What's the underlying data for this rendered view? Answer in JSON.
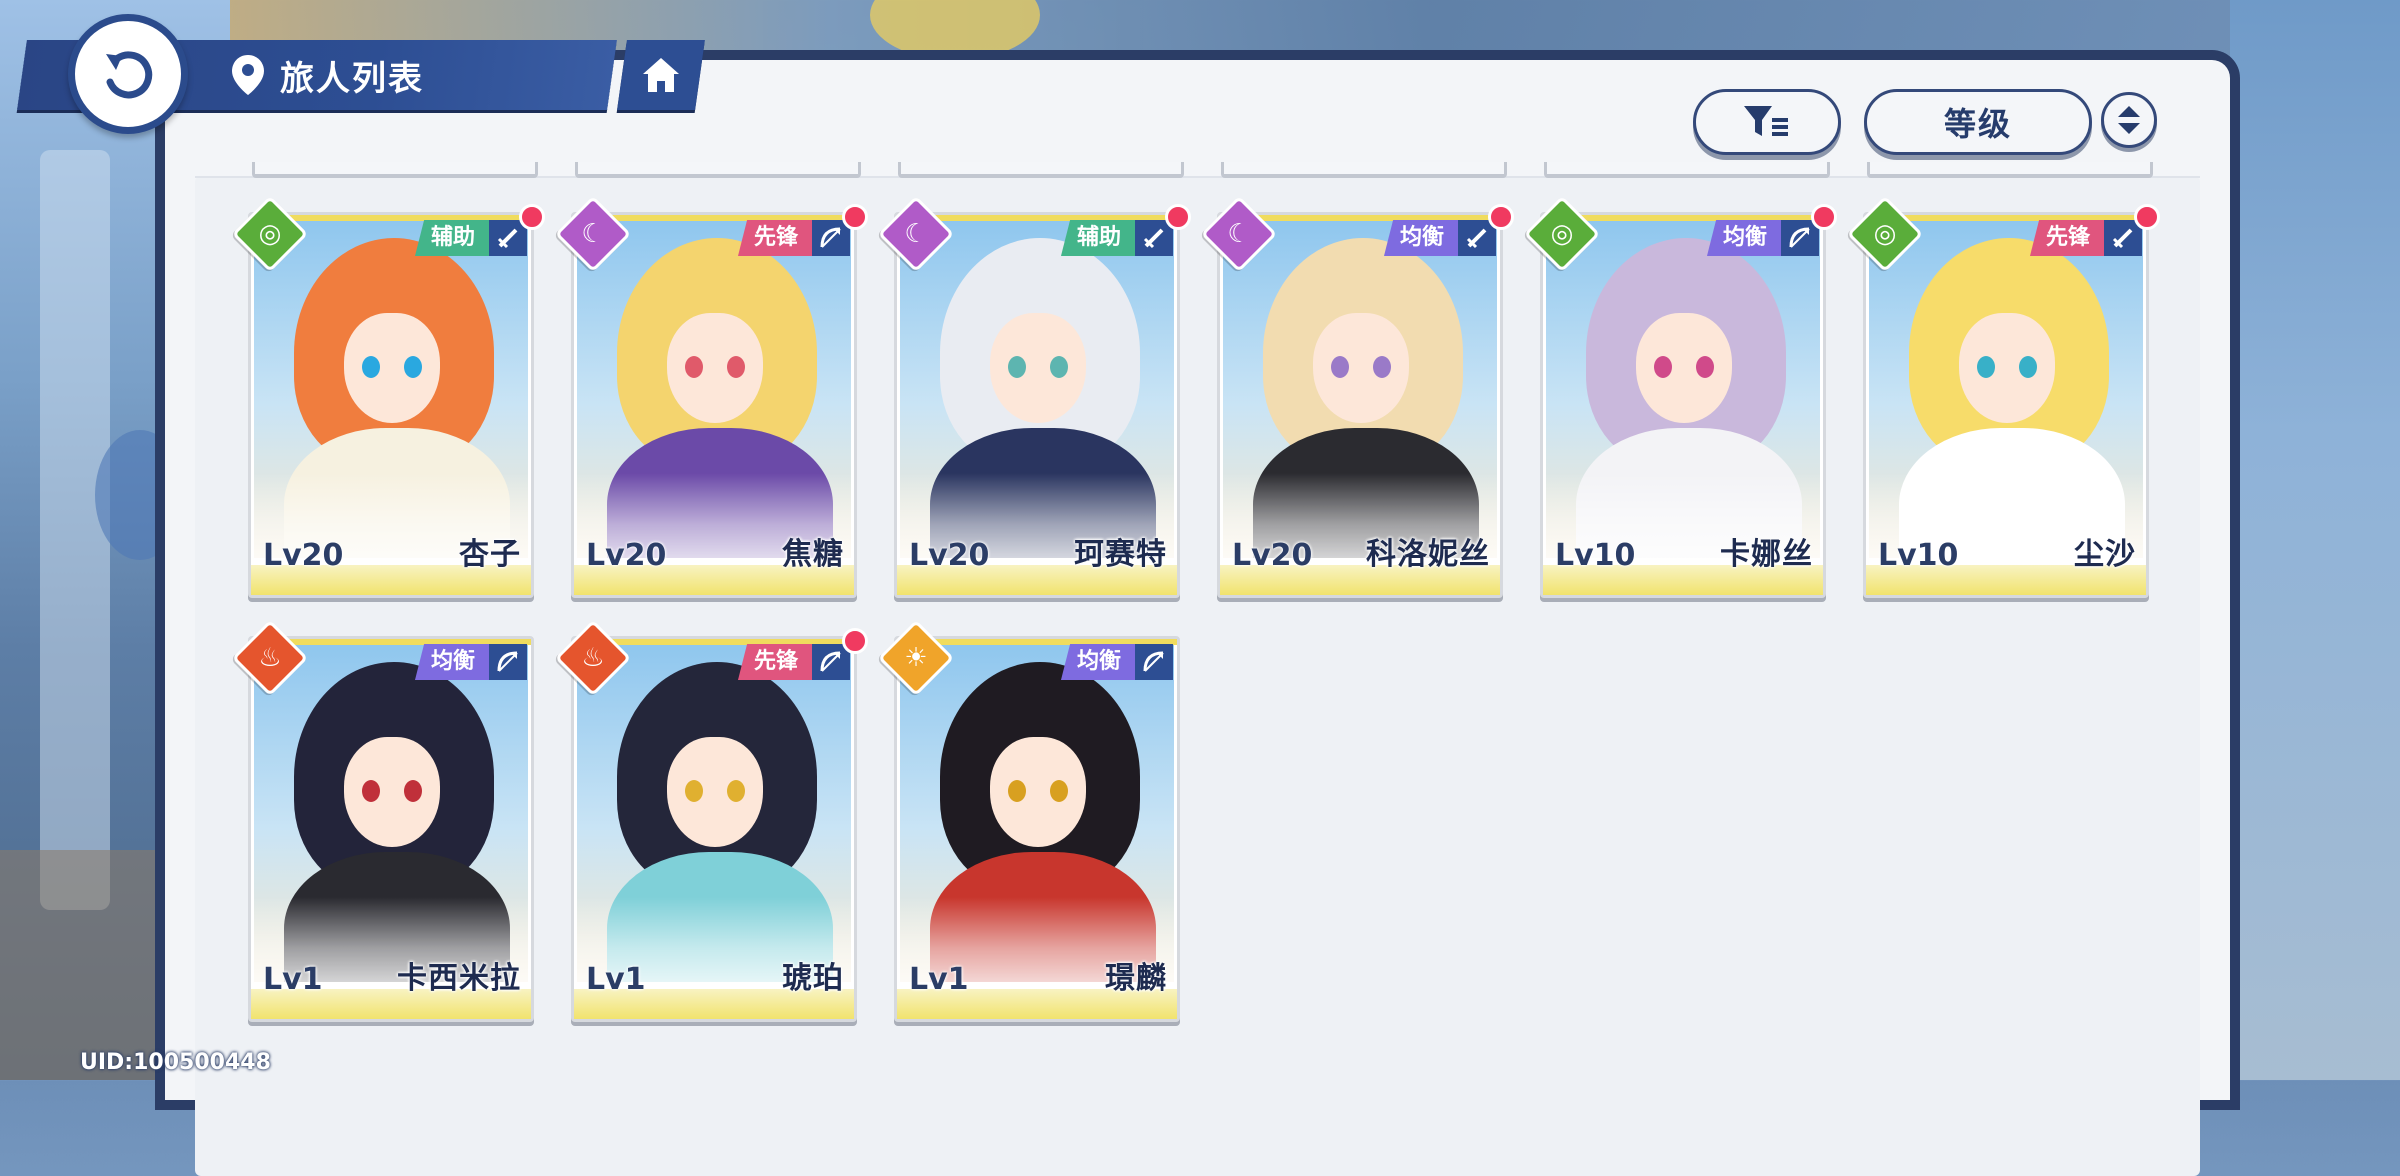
{
  "header": {
    "title": "旅人列表",
    "back_icon": "back-arrow-icon",
    "home_icon": "home-icon",
    "location_icon": "location-pin-icon"
  },
  "controls": {
    "filter_icon": "filter-icon",
    "sort_label": "等级",
    "order_icon": "sort-order-icon"
  },
  "colors": {
    "navy": "#2d4e93",
    "role_support": "#43b58a",
    "role_vanguard": "#e0557e",
    "role_balance": "#7e6be0",
    "elem_wind": "#5aad3a",
    "elem_moon": "#b05bc8",
    "elem_fire": "#e5552d",
    "elem_sun": "#f0a42a",
    "notify_dot": "#f03a60"
  },
  "characters": [
    {
      "level": "Lv20",
      "name": "杏子",
      "role": "辅助",
      "element": "wind",
      "weapon": "sword",
      "notify": true
    },
    {
      "level": "Lv20",
      "name": "焦糖",
      "role": "先锋",
      "element": "moon",
      "weapon": "bow",
      "notify": true
    },
    {
      "level": "Lv20",
      "name": "珂赛特",
      "role": "辅助",
      "element": "moon",
      "weapon": "sword",
      "notify": true
    },
    {
      "level": "Lv20",
      "name": "科洛妮丝",
      "role": "均衡",
      "element": "moon",
      "weapon": "sword",
      "notify": true
    },
    {
      "level": "Lv10",
      "name": "卡娜丝",
      "role": "均衡",
      "element": "wind",
      "weapon": "bow",
      "notify": true
    },
    {
      "level": "Lv10",
      "name": "尘沙",
      "role": "先锋",
      "element": "wind",
      "weapon": "sword",
      "notify": true
    },
    {
      "level": "Lv1",
      "name": "卡西米拉",
      "role": "均衡",
      "element": "fire",
      "weapon": "bow",
      "notify": false
    },
    {
      "level": "Lv1",
      "name": "琥珀",
      "role": "先锋",
      "element": "fire",
      "weapon": "bow",
      "notify": true
    },
    {
      "level": "Lv1",
      "name": "璟麟",
      "role": "均衡",
      "element": "sun",
      "weapon": "bow",
      "notify": false
    }
  ],
  "footer": {
    "uid": "UID:100500448"
  }
}
